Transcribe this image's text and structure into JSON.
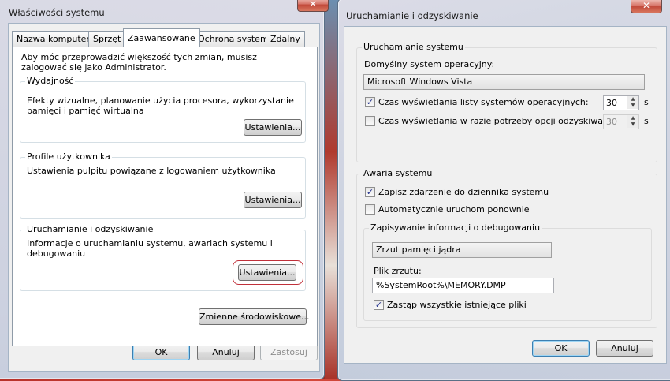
{
  "left_window": {
    "title": "Właściwości systemu",
    "close_glyph": "✕",
    "tabs": [
      "Nazwa komputera",
      "Sprzęt",
      "Zaawansowane",
      "Ochrona systemu",
      "Zdalny"
    ],
    "admin_notice": "Aby móc przeprowadzić większość tych zmian, musisz zalogować się jako Administrator.",
    "performance": {
      "label": "Wydajność",
      "description": "Efekty wizualne, planowanie użycia procesora, wykorzystanie pamięci i pamięć wirtualna",
      "button": "Ustawienia..."
    },
    "user_profiles": {
      "label": "Profile użytkownika",
      "description": "Ustawienia pulpitu powiązane z logowaniem użytkownika",
      "button": "Ustawienia..."
    },
    "startup_recovery": {
      "label": "Uruchamianie i odzyskiwanie",
      "description": "Informacje o uruchamianiu systemu, awariach systemu i debugowaniu",
      "button": "Ustawienia..."
    },
    "env_vars_button": "Zmienne środowiskowe...",
    "ok": "OK",
    "cancel": "Anuluj",
    "apply": "Zastosuj"
  },
  "right_window": {
    "title": "Uruchamianie i odzyskiwanie",
    "close_glyph": "✕",
    "system_startup": {
      "label": "Uruchamianie systemu",
      "default_os_label": "Domyślny system operacyjny:",
      "default_os_value": "Microsoft Windows Vista",
      "os_list_time_label": "Czas wyświetlania listy systemów operacyjnych:",
      "os_list_time_value": "30",
      "os_list_time_checked": true,
      "recovery_time_label": "Czas wyświetlania w razie potrzeby opcji odzyskiwania:",
      "recovery_time_value": "30",
      "recovery_time_checked": false,
      "unit": "s"
    },
    "system_failure": {
      "label": "Awaria systemu",
      "write_event_label": "Zapisz zdarzenie do dziennika systemu",
      "write_event_checked": true,
      "auto_restart_label": "Automatycznie uruchom ponownie",
      "auto_restart_checked": false,
      "debug_info": {
        "label": "Zapisywanie informacji o debugowaniu",
        "dump_type": "Zrzut pamięci jądra",
        "dump_file_label": "Plik zrzutu:",
        "dump_file_value": "%SystemRoot%\\MEMORY.DMP",
        "overwrite_label": "Zastąp wszystkie istniejące pliki",
        "overwrite_checked": true
      }
    },
    "ok": "OK",
    "cancel": "Anuluj"
  },
  "glyphs": {
    "check": "✓",
    "spin_up": "▲",
    "spin_down": "▼"
  }
}
